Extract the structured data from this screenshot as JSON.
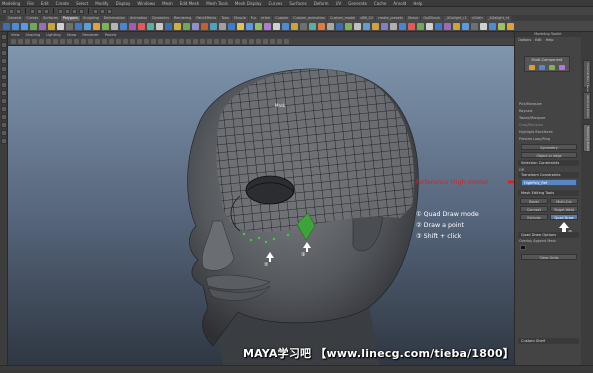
{
  "menubar": {
    "items": [
      "Modeling",
      "File",
      "Edit",
      "Create",
      "Select",
      "Modify",
      "Display",
      "Windows",
      "Mesh",
      "Edit Mesh",
      "Mesh Tools",
      "Mesh Display",
      "Curves",
      "Surfaces",
      "Deform",
      "UV",
      "Generate",
      "Cache",
      "Arnold",
      "Help"
    ]
  },
  "shelf": {
    "tabs": [
      "General",
      "Curves",
      "Surfaces",
      "Polygons",
      "Sculpting",
      "Deformation",
      "Animation",
      "Dynamics",
      "Rendering",
      "PaintEffects",
      "Toon",
      "Muscle",
      "Fur",
      "nHair",
      "Custom",
      "Custom_animation",
      "Custom_model",
      "xBB_03",
      "create_presets",
      "Shave",
      "GoZBrush",
      "_XGalight_r1",
      "nCloth",
      "_XGalight_r4"
    ],
    "active_tab": "Polygons",
    "icon_colors": [
      "#3b6fb0",
      "#4c8bd6",
      "#5a9ae0",
      "#6fa85a",
      "#9c6bb8",
      "#c9a33b",
      "#d1d1d1",
      "#6f6f6f",
      "#3e7bc6",
      "#5d9ed8",
      "#e0a040",
      "#7fb05a",
      "#b5b5b5",
      "#4a86d0",
      "#a05ab8",
      "#e05a5a",
      "#5ab0a0",
      "#c8c8c8",
      "#3b6fb0",
      "#d0b040",
      "#6fa85a",
      "#9090d0",
      "#c06030",
      "#50a0c0",
      "#a0a0a0",
      "#3e7bc6",
      "#e0c060",
      "#5a9ae0",
      "#8fbf6a",
      "#b07ad0",
      "#d0d0d0",
      "#4c8bd6",
      "#c9a33b",
      "#6f6f6f",
      "#5ab0a0",
      "#e07a40",
      "#a8a8a8",
      "#3b6fb0",
      "#7fb05a",
      "#c0c0c0",
      "#5d9ed8",
      "#d1a040",
      "#8080c0",
      "#b0b0b0",
      "#4a86d0",
      "#e05a5a",
      "#6fa85a",
      "#cfcfcf",
      "#3e7bc6",
      "#9c6bb8",
      "#c9a33b",
      "#5a9ae0",
      "#6f6f6f",
      "#d0d0d0",
      "#4c8bd6",
      "#a0c060",
      "#e0a040"
    ]
  },
  "viewport": {
    "menu": [
      "View",
      "Shading",
      "Lighting",
      "Show",
      "Renderer",
      "Panels"
    ],
    "label_mesh": "Mask",
    "marker_2": "②",
    "marker_3": "③"
  },
  "overlay": {
    "steps": [
      "① Quad Draw mode",
      "② Draw a point",
      "③ Shift + click"
    ],
    "reference_label": "Reference High model",
    "watermark": "MAYA学习吧  【www.linecg.com/tieba/1800】"
  },
  "modeling_toolkit": {
    "title": "Modeling Toolkit",
    "tabs": [
      "Options",
      "Edit",
      "Help"
    ],
    "multi_component_label": "Multi-Component",
    "options": [
      "Pick/Marquee",
      "Raycast",
      "Tweak/Marquee",
      "Drag/Marquee",
      "Highlight Backfaces",
      "Preview Loop/Ring"
    ],
    "symmetry_button": "Symmetry",
    "object_button": "Object or edge",
    "soft_select_header": "Selection Constraints",
    "off_option": "Off",
    "transform_header": "Transform Constraints",
    "reference_value": "HighPoly_Ref",
    "mesh_editing_header": "Mesh Editing Tools",
    "tool_buttons": [
      "Bevel",
      "Multi-Cut",
      "Connect",
      "Target Weld",
      "Extrude",
      "Quad Draw"
    ],
    "active_tool": "Quad Draw",
    "quad_draw_header": "Quad Draw Options",
    "quad_draw_option": "Overlay Append Mesh",
    "quad_draw_marker": "①",
    "clear_button": "Clear Grids",
    "custom_shelf_header": "Custom Shelf"
  },
  "side_tabs": [
    "Channel Box / Layer Editor",
    "Attribute Editor",
    "Modeling Toolkit"
  ]
}
